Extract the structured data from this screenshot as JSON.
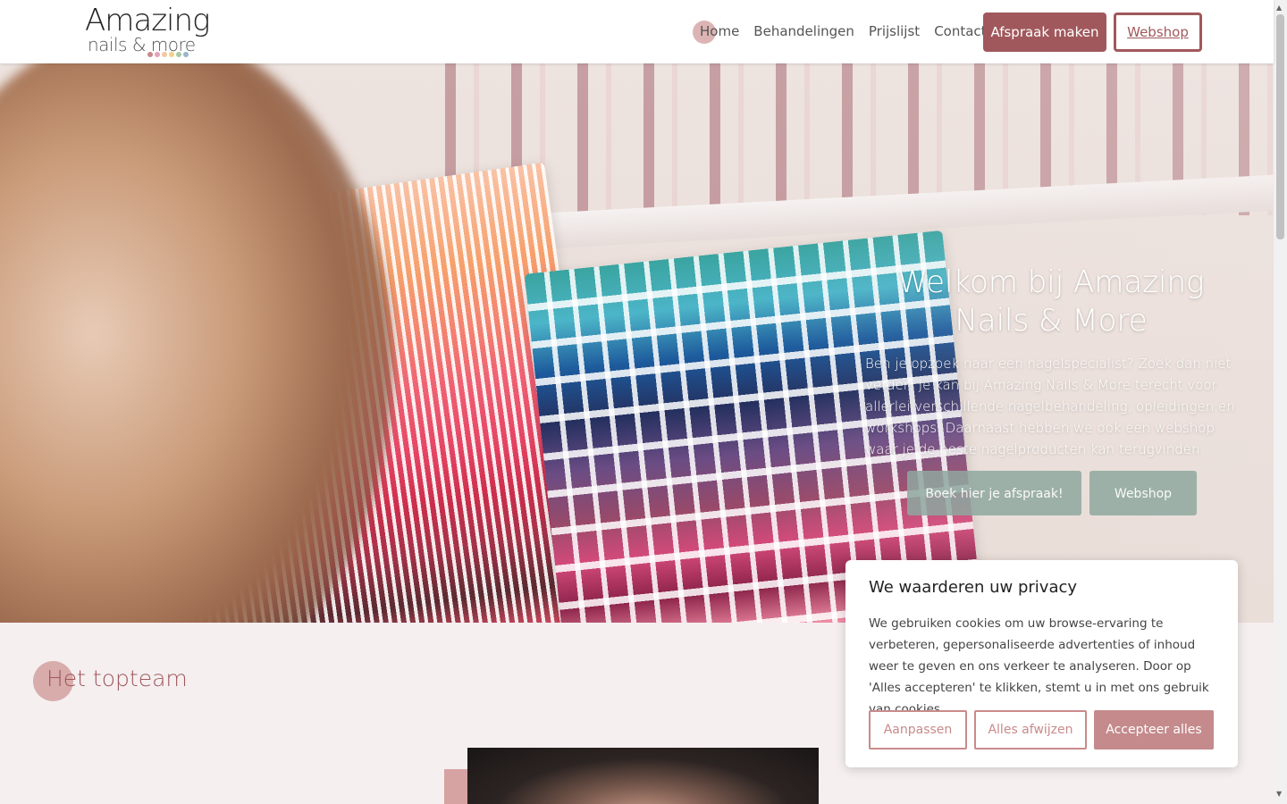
{
  "header": {
    "logo": {
      "title": "Amazing",
      "subtitle": "nails & more",
      "dot_colors": [
        "#c98a8a",
        "#e0a4b8",
        "#f3c6a0",
        "#f2d08a",
        "#a7c9a5",
        "#9db6c8"
      ]
    },
    "nav": [
      {
        "label": "Home",
        "active": true
      },
      {
        "label": "Behandelingen",
        "active": false
      },
      {
        "label": "Prijslijst",
        "active": false
      },
      {
        "label": "Contact",
        "active": false
      }
    ],
    "cta_primary": "Afspraak maken",
    "cta_secondary": "Webshop"
  },
  "hero": {
    "title": "Welkom bij Amazing Nails & More",
    "body": "Ben je opzoek naar een nagelspecialist? Zoek dan niet verder! Je kan bij Amazing Nails & More terecht voor allerlei verschillende nagelbehandeling, opleidingen en workshops. Daarnaast hebben we ook een webshop waar je de beste nagelproducten kan terugvinden.",
    "button_primary": "Boek hier je afspraak!",
    "button_secondary": "Webshop"
  },
  "team_section": {
    "title": "Het topteam"
  },
  "cookie_banner": {
    "title": "We waarderen uw privacy",
    "text": "We gebruiken cookies om uw browse-ervaring te verbeteren, gepersonaliseerde advertenties of inhoud weer te geven en ons verkeer te analyseren. Door op 'Alles accepteren' te klikken, stemt u in met ons gebruik van cookies.",
    "btn_customize": "Aanpassen",
    "btn_reject": "Alles afwijzen",
    "btn_accept": "Accepteer alles"
  },
  "colors": {
    "brand": "#a0585c",
    "accent_pink": "#d29b9b",
    "sage": "#8fa8a0",
    "bg": "#f5eff0"
  }
}
